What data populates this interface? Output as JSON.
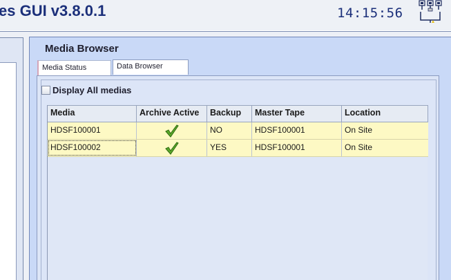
{
  "header": {
    "app_title": "es GUI v3.8.0.1",
    "clock": "14:15:56",
    "network_icon": "network-status-icon"
  },
  "media_browser": {
    "title": "Media Browser",
    "tabs": [
      {
        "label": "Media Status",
        "active": true
      },
      {
        "label": "Data Browser",
        "active": false
      }
    ],
    "display_all": {
      "label": "Display All medias",
      "checked": false
    },
    "table": {
      "columns": [
        "Media",
        "Archive Active",
        "Backup",
        "Master Tape",
        "Location"
      ],
      "rows": [
        {
          "media": "HDSF100001",
          "archive_active": "check-icon",
          "backup": "NO",
          "master_tape": "HDSF100001",
          "location": "On Site"
        },
        {
          "media": "HDSF100002",
          "archive_active": "check-icon",
          "backup": "YES",
          "master_tape": "HDSF100001",
          "location": "On Site"
        }
      ]
    }
  },
  "colors": {
    "title_blue": "#1b2f7a",
    "panel_blue": "#c9d9f7",
    "row_yellow": "#fdf9c4",
    "check_green": "#4a9a1f"
  }
}
